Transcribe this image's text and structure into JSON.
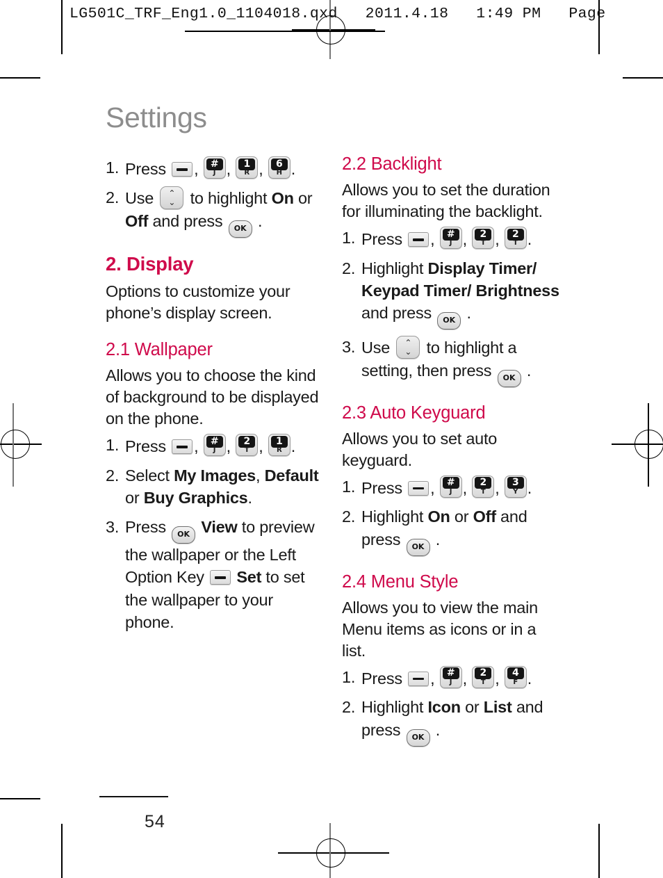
{
  "slug": {
    "text": "LG501C_TRF_Eng1.0_1104018.qxd   2011.4.18   1:49 PM   Page"
  },
  "page": {
    "title": "Settings",
    "number": "54",
    "accent_color": "#cf0a4b",
    "title_color": "#8d8d8d"
  },
  "left_column": {
    "continued_steps": [
      {
        "num": "1.",
        "parts": [
          {
            "t": "text",
            "v": "Press "
          },
          {
            "t": "key-soft",
            "v": "left-option-key"
          },
          {
            "t": "text",
            "v": ", "
          },
          {
            "t": "key",
            "v": "#",
            "sub": "J"
          },
          {
            "t": "text",
            "v": ", "
          },
          {
            "t": "key",
            "v": "1",
            "sub": "R"
          },
          {
            "t": "text",
            "v": ", "
          },
          {
            "t": "key",
            "v": "6",
            "sub": "H"
          },
          {
            "t": "text",
            "v": "."
          }
        ]
      },
      {
        "num": "2.",
        "parts": [
          {
            "t": "text",
            "v": "Use "
          },
          {
            "t": "key-nav",
            "v": "navigation-key"
          },
          {
            "t": "text",
            "v": " to highlight "
          },
          {
            "t": "bold",
            "v": "On"
          },
          {
            "t": "text",
            "v": " or "
          },
          {
            "t": "bold",
            "v": "Off"
          },
          {
            "t": "text",
            "v": " and press "
          },
          {
            "t": "key-ok",
            "v": "OK"
          },
          {
            "t": "text",
            "v": " ."
          }
        ]
      }
    ],
    "section": {
      "heading": "2. Display",
      "description": "Options to customize your phone’s display screen."
    },
    "subsection": {
      "heading": "2.1 Wallpaper",
      "description": "Allows you to choose the kind of background to be displayed on the phone.",
      "steps": [
        {
          "num": "1.",
          "parts": [
            {
              "t": "text",
              "v": "Press "
            },
            {
              "t": "key-soft",
              "v": "left-option-key"
            },
            {
              "t": "text",
              "v": ", "
            },
            {
              "t": "key",
              "v": "#",
              "sub": "J"
            },
            {
              "t": "text",
              "v": ", "
            },
            {
              "t": "key",
              "v": "2",
              "sub": "T"
            },
            {
              "t": "text",
              "v": ", "
            },
            {
              "t": "key",
              "v": "1",
              "sub": "R"
            },
            {
              "t": "text",
              "v": "."
            }
          ]
        },
        {
          "num": "2.",
          "parts": [
            {
              "t": "text",
              "v": "Select "
            },
            {
              "t": "bold",
              "v": "My Images"
            },
            {
              "t": "text",
              "v": ", "
            },
            {
              "t": "bold",
              "v": "Default"
            },
            {
              "t": "text",
              "v": " or "
            },
            {
              "t": "bold",
              "v": "Buy Graphics"
            },
            {
              "t": "text",
              "v": "."
            }
          ]
        },
        {
          "num": "3.",
          "parts": [
            {
              "t": "text",
              "v": "Press "
            },
            {
              "t": "key-ok",
              "v": "OK"
            },
            {
              "t": "text",
              "v": "  "
            },
            {
              "t": "bold",
              "v": "View"
            },
            {
              "t": "text",
              "v": " to preview the wallpaper or the Left Option Key "
            },
            {
              "t": "key-soft",
              "v": "left-option-key"
            },
            {
              "t": "text",
              "v": "  "
            },
            {
              "t": "bold",
              "v": "Set"
            },
            {
              "t": "text",
              "v": " to set the wallpaper to your phone."
            }
          ]
        }
      ]
    }
  },
  "right_column": {
    "sections": [
      {
        "heading": "2.2 Backlight",
        "description": "Allows you to set the duration for illuminating the backlight.",
        "steps": [
          {
            "num": "1.",
            "parts": [
              {
                "t": "text",
                "v": "Press "
              },
              {
                "t": "key-soft",
                "v": "left-option-key"
              },
              {
                "t": "text",
                "v": ", "
              },
              {
                "t": "key",
                "v": "#",
                "sub": "J"
              },
              {
                "t": "text",
                "v": ", "
              },
              {
                "t": "key",
                "v": "2",
                "sub": "T"
              },
              {
                "t": "text",
                "v": ", "
              },
              {
                "t": "key",
                "v": "2",
                "sub": "T"
              },
              {
                "t": "text",
                "v": "."
              }
            ]
          },
          {
            "num": "2.",
            "parts": [
              {
                "t": "text",
                "v": "Highlight "
              },
              {
                "t": "bold",
                "v": "Display Timer/ Keypad Timer/ Brightness"
              },
              {
                "t": "text",
                "v": " and press "
              },
              {
                "t": "key-ok",
                "v": "OK"
              },
              {
                "t": "text",
                "v": " ."
              }
            ]
          },
          {
            "num": "3.",
            "parts": [
              {
                "t": "text",
                "v": "Use "
              },
              {
                "t": "key-nav",
                "v": "navigation-key"
              },
              {
                "t": "text",
                "v": " to highlight a setting, then press "
              },
              {
                "t": "key-ok",
                "v": "OK"
              },
              {
                "t": "text",
                "v": " ."
              }
            ]
          }
        ]
      },
      {
        "heading": "2.3 Auto Keyguard",
        "description": "Allows you to set auto keyguard.",
        "steps": [
          {
            "num": "1.",
            "parts": [
              {
                "t": "text",
                "v": "Press "
              },
              {
                "t": "key-soft",
                "v": "left-option-key"
              },
              {
                "t": "text",
                "v": ", "
              },
              {
                "t": "key",
                "v": "#",
                "sub": "J"
              },
              {
                "t": "text",
                "v": ", "
              },
              {
                "t": "key",
                "v": "2",
                "sub": "T"
              },
              {
                "t": "text",
                "v": ", "
              },
              {
                "t": "key",
                "v": "3",
                "sub": "Y"
              },
              {
                "t": "text",
                "v": "."
              }
            ]
          },
          {
            "num": "2.",
            "parts": [
              {
                "t": "text",
                "v": "Highlight "
              },
              {
                "t": "bold",
                "v": "On"
              },
              {
                "t": "text",
                "v": " or "
              },
              {
                "t": "bold",
                "v": "Off"
              },
              {
                "t": "text",
                "v": " and press "
              },
              {
                "t": "key-ok",
                "v": "OK"
              },
              {
                "t": "text",
                "v": " ."
              }
            ]
          }
        ]
      },
      {
        "heading": "2.4 Menu Style",
        "description": "Allows you to view the main Menu items as icons or in a list.",
        "steps": [
          {
            "num": "1.",
            "parts": [
              {
                "t": "text",
                "v": "Press "
              },
              {
                "t": "key-soft",
                "v": "left-option-key"
              },
              {
                "t": "text",
                "v": ", "
              },
              {
                "t": "key",
                "v": "#",
                "sub": "J"
              },
              {
                "t": "text",
                "v": ", "
              },
              {
                "t": "key",
                "v": "2",
                "sub": "T"
              },
              {
                "t": "text",
                "v": ", "
              },
              {
                "t": "key",
                "v": "4",
                "sub": "F"
              },
              {
                "t": "text",
                "v": "."
              }
            ]
          },
          {
            "num": "2.",
            "parts": [
              {
                "t": "text",
                "v": "Highlight "
              },
              {
                "t": "bold",
                "v": "Icon"
              },
              {
                "t": "text",
                "v": " or "
              },
              {
                "t": "bold",
                "v": "List"
              },
              {
                "t": "text",
                "v": " and press "
              },
              {
                "t": "key-ok",
                "v": "OK"
              },
              {
                "t": "text",
                "v": " ."
              }
            ]
          }
        ]
      }
    ]
  }
}
